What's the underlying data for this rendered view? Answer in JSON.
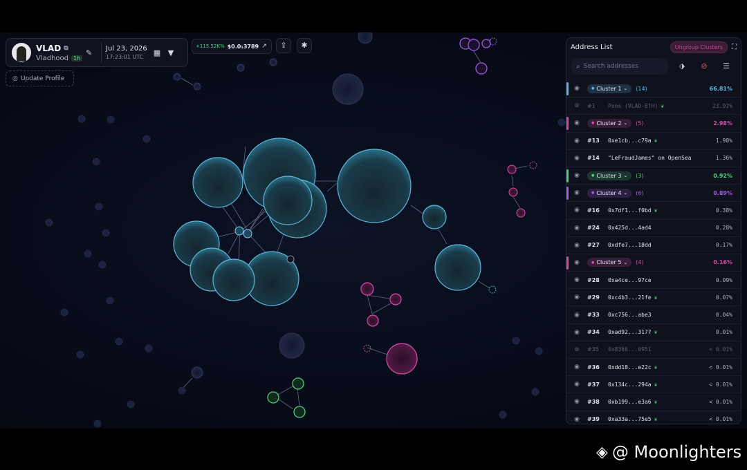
{
  "user": {
    "name": "VLAD",
    "handle": "Vladhood",
    "age_badge": "1h"
  },
  "date": {
    "date": "Jul 23, 2026",
    "time": "17:23:01 UTC"
  },
  "ticker": {
    "change": "+115.52K%",
    "price": "$0.0₁3789"
  },
  "update_profile": "Update Profile",
  "address_list": {
    "title": "Address List",
    "ungroup": "Ungroup Clusters",
    "search_placeholder": "Search addresses",
    "rows": [
      {
        "kind": "cluster",
        "label": "Cluster 1",
        "count": "(14)",
        "pct": "66.81%",
        "color": "#5ab4e0"
      },
      {
        "kind": "addr",
        "hidden": true,
        "idx": "#1",
        "label": "Pons (VLAD-ETH)",
        "sprout": true,
        "pct": "23.92%"
      },
      {
        "kind": "cluster",
        "label": "Cluster 2",
        "count": "(5)",
        "pct": "2.98%",
        "color": "#d94aa6"
      },
      {
        "kind": "addr",
        "idx": "#13",
        "label": "0xe1cb...c79a",
        "sprout": true,
        "pct": "1.98%"
      },
      {
        "kind": "addr",
        "idx": "#14",
        "label": "\"LeFraudJames\" on OpenSea",
        "sprout": false,
        "pct": "1.36%"
      },
      {
        "kind": "cluster",
        "label": "Cluster 3",
        "count": "(3)",
        "pct": "0.92%",
        "color": "#4fcf7e"
      },
      {
        "kind": "cluster",
        "label": "Cluster 4",
        "count": "(6)",
        "pct": "0.89%",
        "color": "#a05ae0"
      },
      {
        "kind": "addr",
        "idx": "#16",
        "label": "0x7df1...f0bd",
        "sprout": true,
        "pct": "0.38%"
      },
      {
        "kind": "addr",
        "idx": "#24",
        "label": "0x425d...4ad4",
        "sprout": false,
        "pct": "0.28%"
      },
      {
        "kind": "addr",
        "idx": "#27",
        "label": "0xdfe7...18dd",
        "sprout": false,
        "pct": "0.17%"
      },
      {
        "kind": "cluster",
        "label": "Cluster 5",
        "count": "(4)",
        "pct": "0.16%",
        "color": "#d94aa6"
      },
      {
        "kind": "addr",
        "idx": "#28",
        "label": "0xa4ce...97ce",
        "sprout": false,
        "pct": "0.09%"
      },
      {
        "kind": "addr",
        "idx": "#29",
        "label": "0xc4b3...21fe",
        "sprout": true,
        "pct": "0.07%"
      },
      {
        "kind": "addr",
        "idx": "#33",
        "label": "0xc756...abe3",
        "sprout": false,
        "pct": "0.04%"
      },
      {
        "kind": "addr",
        "idx": "#34",
        "label": "0xad92...3177",
        "sprout": true,
        "pct": "0.01%"
      },
      {
        "kind": "addr",
        "hidden": true,
        "idx": "#35",
        "label": "0x8366...0951",
        "sprout": false,
        "pct": "< 0.01%"
      },
      {
        "kind": "addr",
        "idx": "#36",
        "label": "0xdd18...e22c",
        "sprout": true,
        "pct": "< 0.01%"
      },
      {
        "kind": "addr",
        "idx": "#37",
        "label": "0x134c...294a",
        "sprout": true,
        "pct": "< 0.01%"
      },
      {
        "kind": "addr",
        "idx": "#38",
        "label": "0xb199...e3a6",
        "sprout": true,
        "pct": "< 0.01%"
      },
      {
        "kind": "addr",
        "idx": "#39",
        "label": "0xa33a...75e5",
        "sprout": true,
        "pct": "< 0.01%"
      }
    ]
  },
  "watermark": "@ Moonlighters",
  "icons": {
    "edit": "pencil-icon",
    "calendar": "calendar-icon",
    "filter": "filter-icon",
    "share": "share-icon",
    "tools": "wrench-icon",
    "eye": "eye-icon"
  }
}
